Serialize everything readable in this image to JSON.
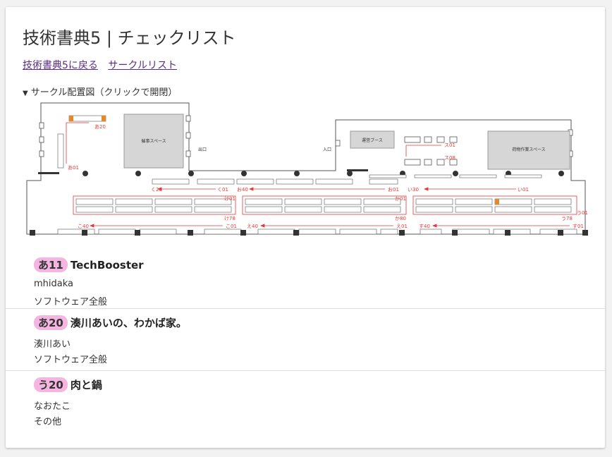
{
  "page": {
    "title": "技術書典5 | チェックリスト",
    "links": {
      "back": "技術書典5に戻る",
      "circle_list": "サークルリスト"
    },
    "map_toggle": "サークル配置図（クリックで開閉）"
  },
  "map": {
    "labels": {
      "stage": "催事スペース",
      "exit": "出口",
      "entrance": "入口",
      "sponsor": "運営ブース",
      "cargo": "荷物作業スペース",
      "a01": "あ01",
      "a20": "あ20",
      "ku20": "く20",
      "ku01": "く01",
      "o40": "お40",
      "o01": "お01",
      "i30": "い30",
      "i01": "い01",
      "ke01": "け01",
      "ke78": "け78",
      "ka01": "か01",
      "ka80": "か80",
      "u01": "う01",
      "u78": "う78",
      "ko40": "こ40",
      "ko01": "こ01",
      "e40": "え40",
      "e01": "え01",
      "su40": "す40",
      "su01": "す01",
      "su01b": "ス01",
      "su08": "ス08"
    }
  },
  "circles": [
    {
      "space": "あ11",
      "name": "TechBooster",
      "author": "mhidaka",
      "genre": "ソフトウェア全般"
    },
    {
      "space": "あ20",
      "name": "湊川あいの、わかば家。",
      "author": "湊川あい",
      "genre": "ソフトウェア全般"
    },
    {
      "space": "う20",
      "name": "肉と鍋",
      "author": "なおたこ",
      "genre": "その他"
    }
  ]
}
